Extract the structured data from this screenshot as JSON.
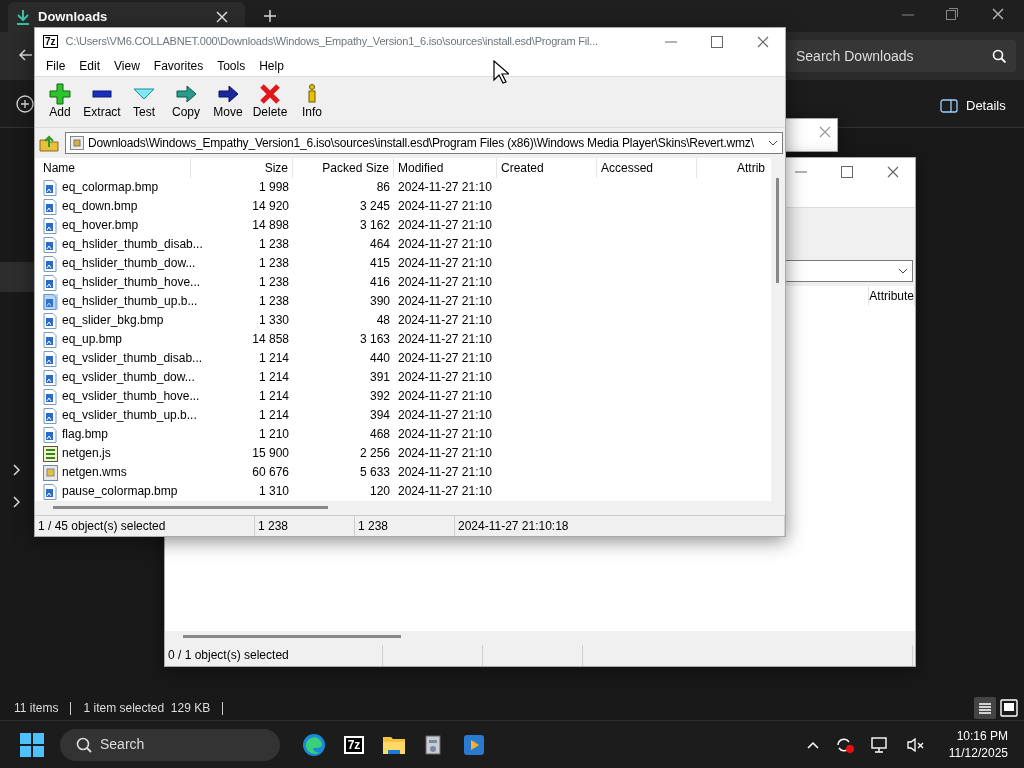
{
  "explorer": {
    "tab_title": "Downloads",
    "search_placeholder": "Search Downloads",
    "details_button": "Details",
    "status": [
      "11 items",
      "1 item selected  129 KB"
    ]
  },
  "back_window": {
    "columns": [
      "Attribute"
    ],
    "status": "0 / 1 object(s) selected"
  },
  "window": {
    "app_icon": "7z",
    "title": "C:\\Users\\VM6.COLLABNET.000\\Downloads\\Windows_Empathy_Version1_6.iso\\sources\\install.esd\\Program Fil...",
    "menu": [
      "File",
      "Edit",
      "View",
      "Favorites",
      "Tools",
      "Help"
    ],
    "toolbar": [
      {
        "label": "Add",
        "kind": "add"
      },
      {
        "label": "Extract",
        "kind": "extract"
      },
      {
        "label": "Test",
        "kind": "test"
      },
      {
        "label": "Copy",
        "kind": "copy"
      },
      {
        "label": "Move",
        "kind": "move"
      },
      {
        "label": "Delete",
        "kind": "delete"
      },
      {
        "label": "Info",
        "kind": "info"
      }
    ],
    "address": "Downloads\\Windows_Empathy_Version1_6.iso\\sources\\install.esd\\Program Files (x86)\\Windows Media Player\\Skins\\Revert.wmz\\",
    "columns": [
      "Name",
      "Size",
      "Packed Size",
      "Modified",
      "Created",
      "Accessed",
      "Attrib"
    ],
    "rows": [
      {
        "name": "eq_colormap.bmp",
        "size": "1 998",
        "packed": "86",
        "modified": "2024-11-27 21:10",
        "kind": "bmp",
        "selected": false
      },
      {
        "name": "eq_down.bmp",
        "size": "14 920",
        "packed": "3 245",
        "modified": "2024-11-27 21:10",
        "kind": "bmp",
        "selected": false
      },
      {
        "name": "eq_hover.bmp",
        "size": "14 898",
        "packed": "3 162",
        "modified": "2024-11-27 21:10",
        "kind": "bmp",
        "selected": false
      },
      {
        "name": "eq_hslider_thumb_disab...",
        "size": "1 238",
        "packed": "464",
        "modified": "2024-11-27 21:10",
        "kind": "bmp",
        "selected": false
      },
      {
        "name": "eq_hslider_thumb_dow...",
        "size": "1 238",
        "packed": "415",
        "modified": "2024-11-27 21:10",
        "kind": "bmp",
        "selected": false
      },
      {
        "name": "eq_hslider_thumb_hove...",
        "size": "1 238",
        "packed": "416",
        "modified": "2024-11-27 21:10",
        "kind": "bmp",
        "selected": false
      },
      {
        "name": "eq_hslider_thumb_up.b...",
        "size": "1 238",
        "packed": "390",
        "modified": "2024-11-27 21:10",
        "kind": "bmp",
        "selected": true
      },
      {
        "name": "eq_slider_bkg.bmp",
        "size": "1 330",
        "packed": "48",
        "modified": "2024-11-27 21:10",
        "kind": "bmp",
        "selected": false
      },
      {
        "name": "eq_up.bmp",
        "size": "14 858",
        "packed": "3 163",
        "modified": "2024-11-27 21:10",
        "kind": "bmp",
        "selected": false
      },
      {
        "name": "eq_vslider_thumb_disab...",
        "size": "1 214",
        "packed": "440",
        "modified": "2024-11-27 21:10",
        "kind": "bmp",
        "selected": false
      },
      {
        "name": "eq_vslider_thumb_dow...",
        "size": "1 214",
        "packed": "391",
        "modified": "2024-11-27 21:10",
        "kind": "bmp",
        "selected": false
      },
      {
        "name": "eq_vslider_thumb_hove...",
        "size": "1 214",
        "packed": "392",
        "modified": "2024-11-27 21:10",
        "kind": "bmp",
        "selected": false
      },
      {
        "name": "eq_vslider_thumb_up.b...",
        "size": "1 214",
        "packed": "394",
        "modified": "2024-11-27 21:10",
        "kind": "bmp",
        "selected": false
      },
      {
        "name": "flag.bmp",
        "size": "1 210",
        "packed": "468",
        "modified": "2024-11-27 21:10",
        "kind": "bmp",
        "selected": false
      },
      {
        "name": "netgen.js",
        "size": "15 900",
        "packed": "2 256",
        "modified": "2024-11-27 21:10",
        "kind": "js",
        "selected": false
      },
      {
        "name": "netgen.wms",
        "size": "60 676",
        "packed": "5 633",
        "modified": "2024-11-27 21:10",
        "kind": "wms",
        "selected": false
      },
      {
        "name": "pause_colormap.bmp",
        "size": "1 310",
        "packed": "120",
        "modified": "2024-11-27 21:10",
        "kind": "bmp",
        "selected": false
      }
    ],
    "status": [
      "1 / 45 object(s) selected",
      "1 238",
      "1 238",
      "2024-11-27 21:10:18"
    ]
  },
  "taskbar": {
    "search": "Search",
    "apps": [
      {
        "kind": "edge"
      },
      {
        "kind": "sevenzip",
        "label": "7z"
      },
      {
        "kind": "folder"
      },
      {
        "kind": "tools"
      },
      {
        "kind": "player"
      }
    ],
    "time": "10:16 PM",
    "date": "11/12/2025"
  }
}
